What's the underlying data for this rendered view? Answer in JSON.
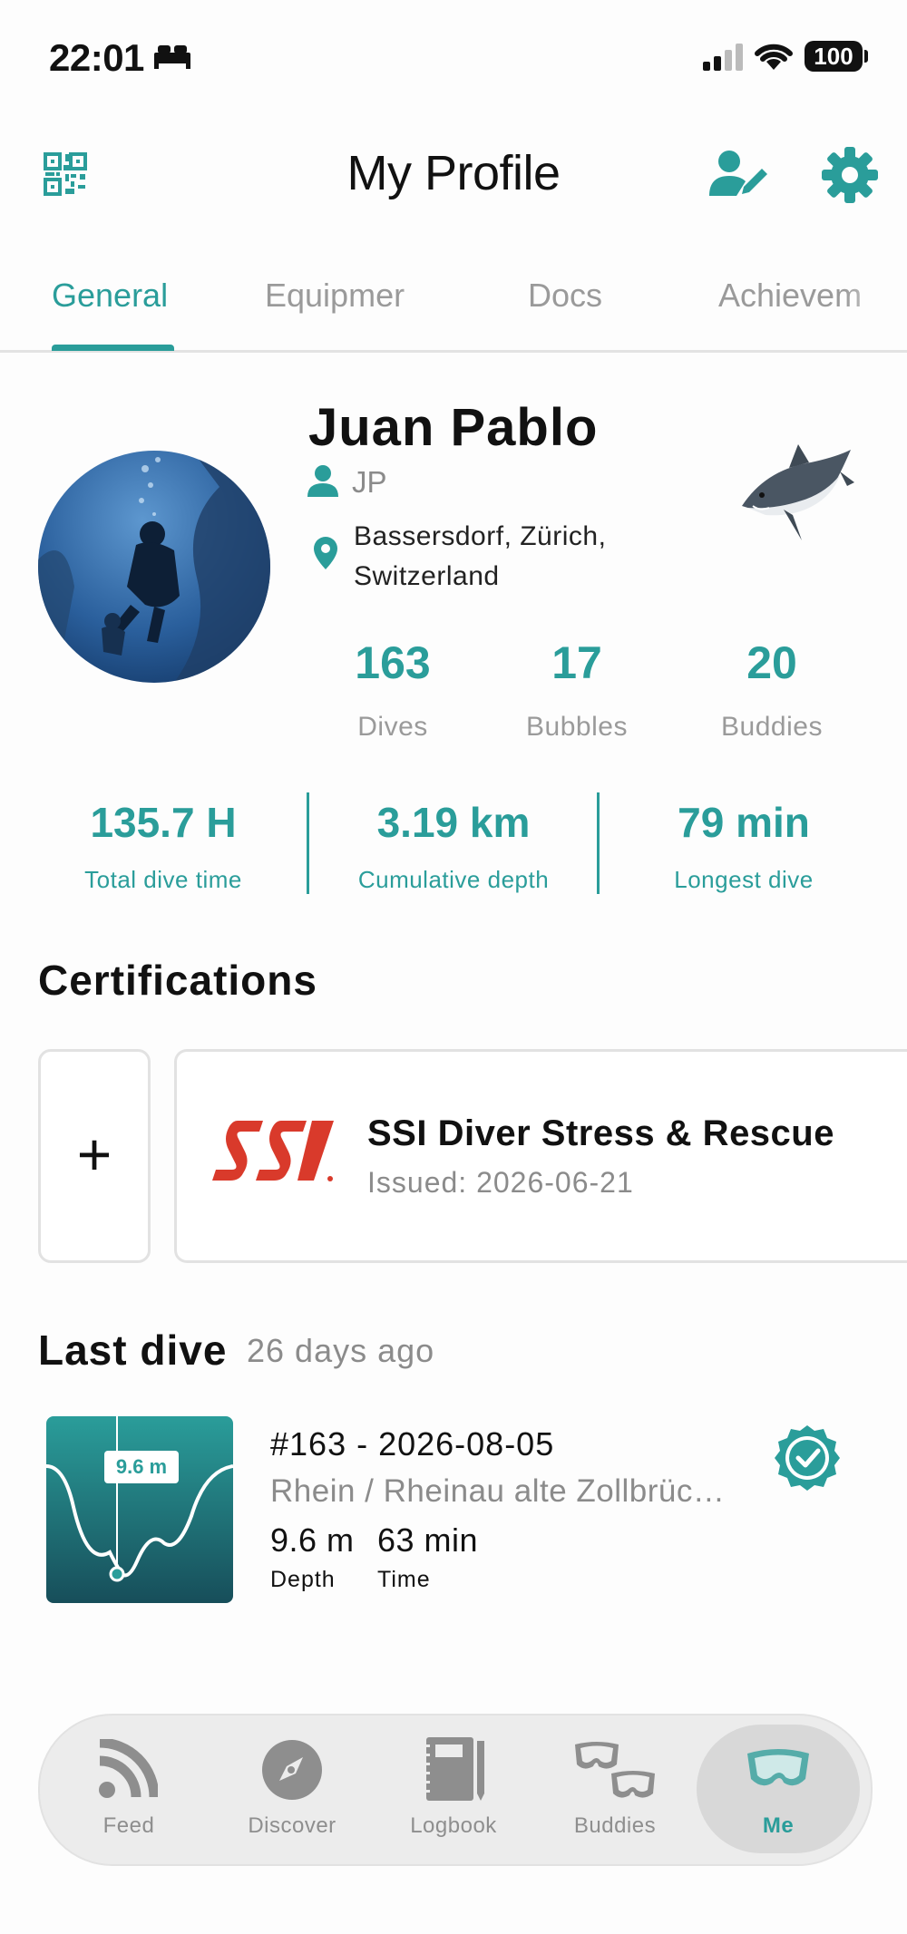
{
  "status_bar": {
    "time": "22:01",
    "battery": "100"
  },
  "header": {
    "title": "My Profile"
  },
  "tabs": [
    {
      "label": "General",
      "active": true
    },
    {
      "label": "Equipmer"
    },
    {
      "label": "Docs"
    },
    {
      "label": "Achievem"
    }
  ],
  "profile": {
    "name": "Juan Pablo",
    "username": "JP",
    "location_line1": "Bassersdorf, Zürich,",
    "location_line2": "Switzerland",
    "stats": [
      {
        "value": "163",
        "label": "Dives"
      },
      {
        "value": "17",
        "label": "Bubbles"
      },
      {
        "value": "20",
        "label": "Buddies"
      }
    ],
    "metrics": [
      {
        "value": "135.7 H",
        "label": "Total dive time"
      },
      {
        "value": "3.19 km",
        "label": "Cumulative depth"
      },
      {
        "value": "79 min",
        "label": "Longest dive"
      }
    ]
  },
  "certifications": {
    "title": "Certifications",
    "add_symbol": "+",
    "items": [
      {
        "logo": "SSI",
        "name": "SSI Diver Stress & Rescue",
        "issued": "Issued: 2026-06-21"
      }
    ]
  },
  "last_dive": {
    "title": "Last dive",
    "ago": "26 days ago",
    "graph_label": "9.6 m",
    "dive_title": "#163 - 2026-08-05",
    "location": "Rhein / Rheinau alte Zollbrüc…",
    "depth_value": "9.6 m",
    "time_value": "63 min",
    "depth_label": "Depth",
    "time_label": "Time"
  },
  "bottom_nav": [
    {
      "label": "Feed",
      "icon": "rss-icon"
    },
    {
      "label": "Discover",
      "icon": "compass-icon"
    },
    {
      "label": "Logbook",
      "icon": "notebook-icon"
    },
    {
      "label": "Buddies",
      "icon": "diving-masks-icon"
    },
    {
      "label": "Me",
      "icon": "diving-mask-icon",
      "active": true
    }
  ],
  "colors": {
    "accent": "#2a9d9a",
    "muted": "#9a9a9a",
    "ssi_red": "#d93a2b"
  }
}
